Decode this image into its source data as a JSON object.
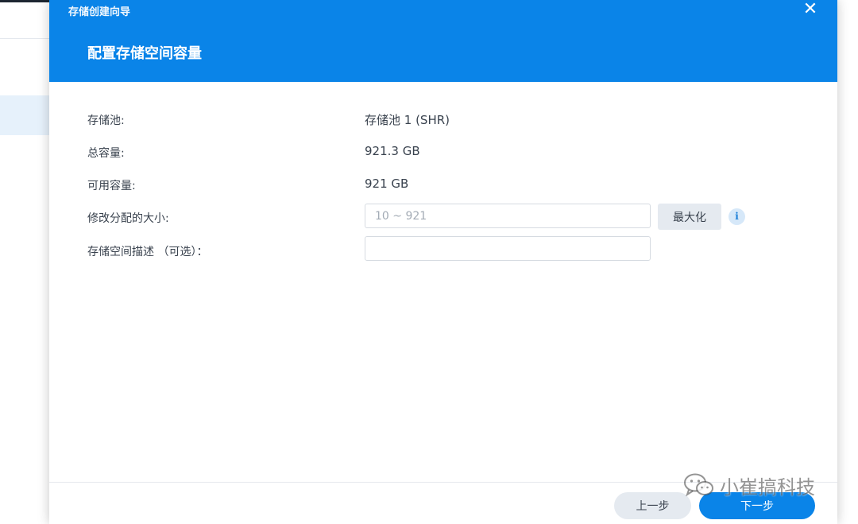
{
  "dialog": {
    "window_title": "存储创建向导",
    "step_title": "配置存储空间容量",
    "close_icon": "close-icon"
  },
  "form": {
    "storage_pool_label": "存储池:",
    "storage_pool_value": "存储池 1 (SHR)",
    "total_capacity_label": "总容量:",
    "total_capacity_value": "921.3 GB",
    "available_capacity_label": "可用容量:",
    "available_capacity_value": "921 GB",
    "allocated_size_label": "修改分配的大小:",
    "allocated_size_placeholder": "10 ~ 921",
    "allocated_size_value": "",
    "maximize_label": "最大化",
    "info_icon": "info-icon",
    "description_label": "存储空间描述 （可选）：",
    "description_value": ""
  },
  "footer": {
    "prev_label": "上一步",
    "next_label": "下一步"
  },
  "watermark": {
    "text": "小崔搞科技",
    "icon": "wechat-icon"
  },
  "colors": {
    "header_bg": "#0a84e8",
    "primary_button": "#0a84e8",
    "secondary_button": "#e5eaf0",
    "text": "#39424e"
  }
}
